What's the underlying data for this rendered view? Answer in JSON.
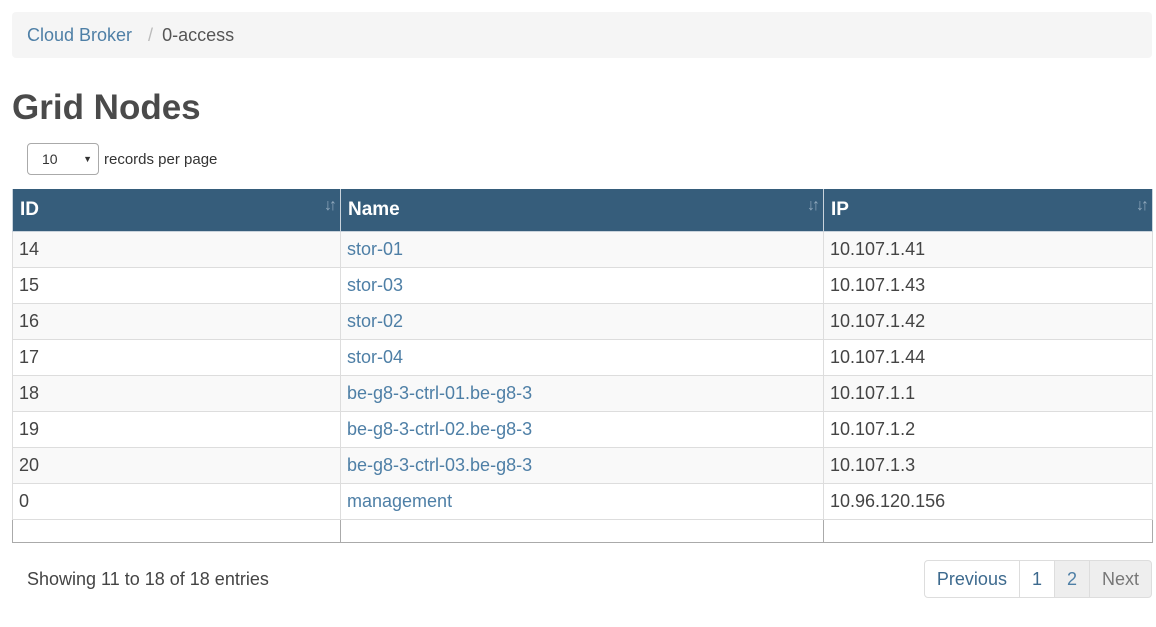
{
  "breadcrumb": {
    "root": "Cloud Broker",
    "separator": "/",
    "current": "0-access"
  },
  "page": {
    "title": "Grid Nodes"
  },
  "length_menu": {
    "value": "10",
    "label": "records per page"
  },
  "table": {
    "columns": [
      "ID",
      "Name",
      "IP"
    ],
    "rows": [
      {
        "id": "14",
        "name": "stor-01",
        "ip": "10.107.1.41"
      },
      {
        "id": "15",
        "name": "stor-03",
        "ip": "10.107.1.43"
      },
      {
        "id": "16",
        "name": "stor-02",
        "ip": "10.107.1.42"
      },
      {
        "id": "17",
        "name": "stor-04",
        "ip": "10.107.1.44"
      },
      {
        "id": "18",
        "name": "be-g8-3-ctrl-01.be-g8-3",
        "ip": "10.107.1.1"
      },
      {
        "id": "19",
        "name": "be-g8-3-ctrl-02.be-g8-3",
        "ip": "10.107.1.2"
      },
      {
        "id": "20",
        "name": "be-g8-3-ctrl-03.be-g8-3",
        "ip": "10.107.1.3"
      },
      {
        "id": "0",
        "name": "management",
        "ip": "10.96.120.156"
      }
    ]
  },
  "footer": {
    "info": "Showing 11 to 18 of 18 entries"
  },
  "pagination": {
    "previous": "Previous",
    "pages": [
      "1",
      "2"
    ],
    "active_page": "2",
    "next": "Next"
  },
  "colors": {
    "header_bg": "#365d7b",
    "link": "#4e7fa6"
  },
  "icons": {
    "sort": "sort-icon",
    "dropdown": "chevron-down-icon"
  }
}
